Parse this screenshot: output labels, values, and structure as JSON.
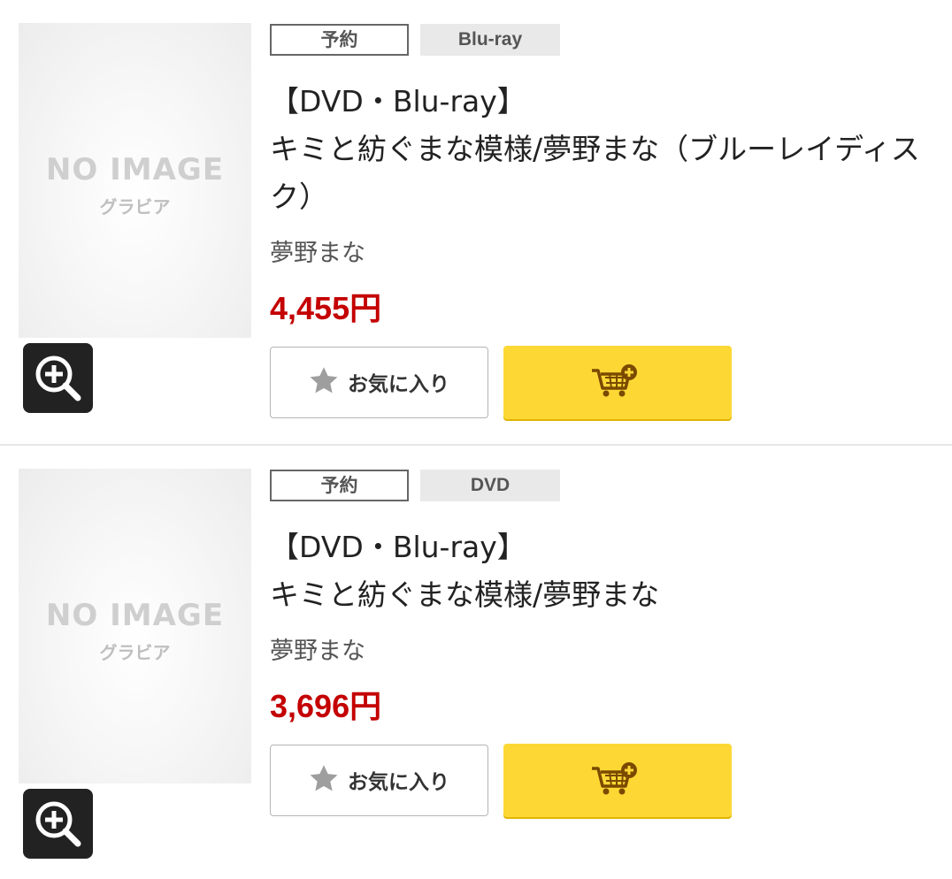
{
  "colors": {
    "price": "#c40000",
    "cart_button": "#fdd835",
    "zoom_button": "#222222"
  },
  "icons": {
    "zoom": "zoom-in-icon",
    "favorite": "star-icon",
    "cart": "cart-add-icon"
  },
  "items": [
    {
      "thumb_text": "NO IMAGE",
      "thumb_sub": "グラビア",
      "tag_status": "予約",
      "tag_format": "Blu-ray",
      "title_line1": "【DVD・Blu-ray】",
      "title_line2": "キミと紡ぐまな模様/夢野まな（ブルーレイディス",
      "title_line3": "ク）",
      "artist": "夢野まな",
      "price": "4,455円",
      "favorite_label": "お気に入り"
    },
    {
      "thumb_text": "NO IMAGE",
      "thumb_sub": "グラビア",
      "tag_status": "予約",
      "tag_format": "DVD",
      "title_line1": "【DVD・Blu-ray】",
      "title_line2": "キミと紡ぐまな模様/夢野まな",
      "title_line3": "",
      "artist": "夢野まな",
      "price": "3,696円",
      "favorite_label": "お気に入り"
    }
  ]
}
